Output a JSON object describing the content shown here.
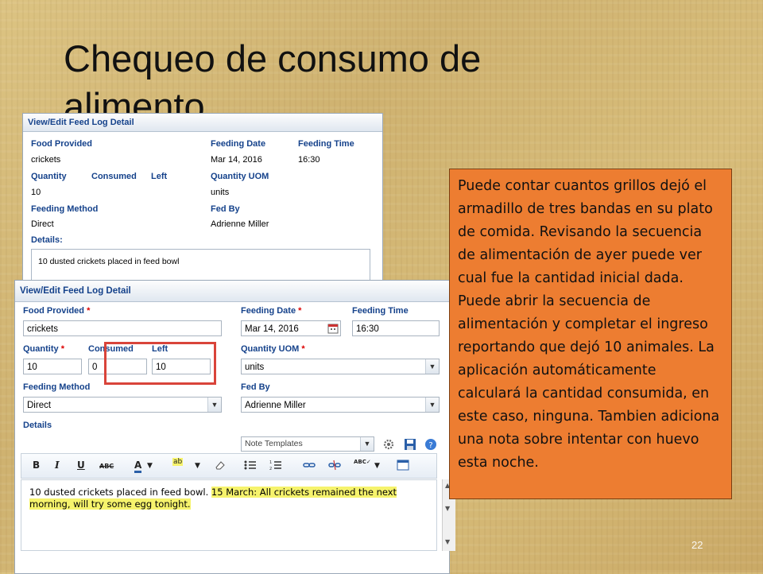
{
  "slide": {
    "title_line1": "Chequeo de consumo de",
    "title_line2": "alimento",
    "page_number": "22"
  },
  "back_panel": {
    "header": "View/Edit Feed Log Detail",
    "labels": {
      "food_provided": "Food Provided",
      "feeding_date": "Feeding Date",
      "feeding_time": "Feeding Time",
      "quantity": "Quantity",
      "consumed": "Consumed",
      "left": "Left",
      "quantity_uom": "Quantity UOM",
      "feeding_method": "Feeding Method",
      "fed_by": "Fed By",
      "details": "Details:"
    },
    "values": {
      "food_provided": "crickets",
      "feeding_date": "Mar 14, 2016",
      "feeding_time": "16:30",
      "quantity": "10",
      "quantity_uom": "units",
      "feeding_method": "Direct",
      "fed_by": "Adrienne Miller",
      "details": "10 dusted crickets placed in feed bowl"
    }
  },
  "front_panel": {
    "header": "View/Edit Feed Log Detail",
    "required_marker": "*",
    "labels": {
      "food_provided": "Food Provided",
      "feeding_date": "Feeding Date",
      "feeding_time": "Feeding Time",
      "quantity": "Quantity",
      "consumed": "Consumed",
      "left": "Left",
      "quantity_uom": "Quantity UOM",
      "feeding_method": "Feeding Method",
      "fed_by": "Fed By",
      "details": "Details"
    },
    "values": {
      "food_provided": "crickets",
      "feeding_date": "Mar 14, 2016",
      "feeding_time": "16:30",
      "quantity": "10",
      "consumed": "0",
      "left": "10",
      "quantity_uom": "units",
      "feeding_method": "Direct",
      "fed_by": "Adrienne Miller"
    },
    "note_templates": "Note Templates",
    "editor": {
      "existing_text": "10 dusted crickets placed in feed bowl.",
      "added_note_1": "15 March: All crickets remained the next",
      "added_note_2": "morning, will try some egg tonight."
    }
  },
  "callout": {
    "text": "Puede contar cuantos grillos dejó el armadillo de tres bandas en su plato de comida. Revisando la secuencia de alimentación de ayer puede ver cual fue la cantidad inicial dada. Puede abrir la secuencia de alimentación y completar el ingreso reportando que dejó 10 animales. La aplicación automáticamente calculará la cantidad consumida, en este caso, ninguna. Tambien adiciona una nota sobre intentar con huevo esta noche."
  },
  "colors": {
    "callout_background": "#ed7d31",
    "highlight_border": "#d9443a",
    "label_blue": "#15428b",
    "note_highlight": "#f6f36c"
  },
  "icons": [
    "calendar-icon",
    "dropdown-arrow-icon",
    "gear-icon",
    "save-icon",
    "help-icon",
    "bold-icon",
    "italic-icon",
    "underline-icon",
    "strikethrough-icon",
    "font-color-icon",
    "highlight-color-icon",
    "eraser-icon",
    "bullet-list-icon",
    "numbered-list-icon",
    "link-icon",
    "unlink-icon",
    "spellcheck-icon",
    "source-icon"
  ]
}
